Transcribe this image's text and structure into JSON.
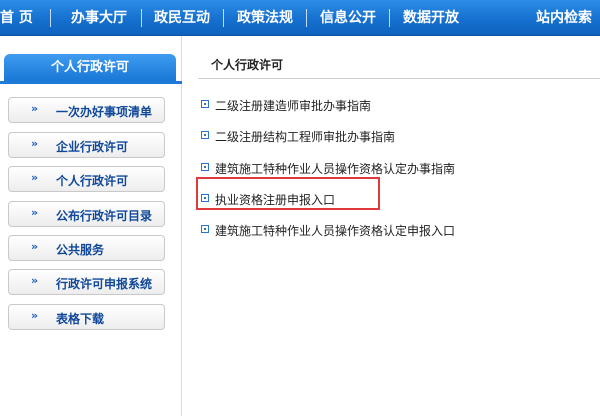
{
  "nav": {
    "items": [
      "首 页",
      "办事大厅",
      "政民互动",
      "政策法规",
      "信息公开",
      "数据开放",
      "站内检索"
    ]
  },
  "sidebar": {
    "header": "个人行政许可",
    "items": [
      {
        "arrows": "»",
        "label": "一次办好事项清单"
      },
      {
        "arrows": "»",
        "label": "企业行政许可"
      },
      {
        "arrows": "»",
        "label": "个人行政许可"
      },
      {
        "arrows": "»",
        "label": "公布行政许可目录"
      },
      {
        "arrows": "»",
        "label": "公共服务"
      },
      {
        "arrows": "»",
        "label": "行政许可申报系统"
      },
      {
        "arrows": "»",
        "label": "表格下载"
      }
    ]
  },
  "main": {
    "title": "个人行政许可",
    "items": [
      "二级注册建造师审批办事指南",
      "二级注册结构工程师审批办事指南",
      "建筑施工特种作业人员操作资格认定办事指南",
      "执业资格注册申报入口",
      "建筑施工特种作业人员操作资格认定申报入口"
    ]
  },
  "colors": {
    "nav_blue": "#1670cf",
    "link_blue": "#11489a",
    "highlight_red": "#e03a3a"
  }
}
